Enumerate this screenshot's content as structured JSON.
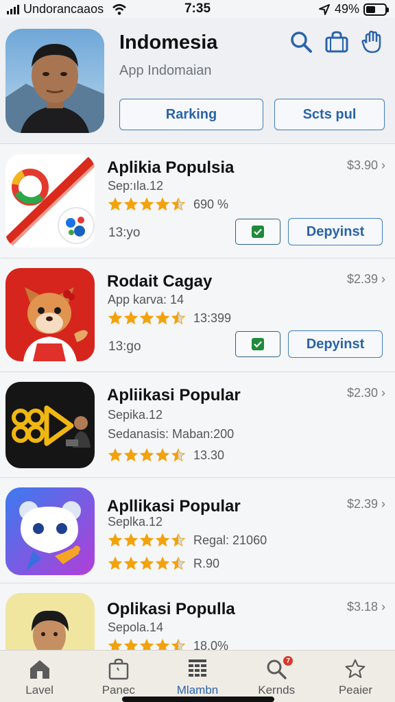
{
  "status": {
    "carrier": "Undorancaaos",
    "time": "7:35",
    "battery": "49%",
    "battery_level": 0.49
  },
  "header": {
    "title": "Indomesia",
    "subtitle": "App Indomaian",
    "buttons": [
      "Rarking",
      "Scts pul"
    ],
    "icons": [
      "search-icon",
      "shopping-bag-icon",
      "hand-icon"
    ]
  },
  "apps": [
    {
      "name": "Aplikia Populsia",
      "price": "$3.90",
      "line": "Sep:ıla.12",
      "rating_stars": 4.5,
      "rating_text": "690 %",
      "time": "13:yo",
      "action": "Depyinst",
      "icon": "color-swirl-icon"
    },
    {
      "name": "Rodait Cagay",
      "price": "$2.39",
      "line": "App karva: 14",
      "rating_stars": 4.5,
      "rating_text": "13:399",
      "time": "13:go",
      "action": "Depyinst",
      "icon": "fox-mascot-icon"
    },
    {
      "name": "Apliikasi Popular",
      "price": "$2.30",
      "line": "Sepika.12",
      "line2": "Sedanasis: Maban:200",
      "rating_stars": 4.5,
      "rating_text": "13.30",
      "icon": "play-video-icon"
    },
    {
      "name": "Apllikasi Popular",
      "price": "$2.39",
      "line": "Seplka.12",
      "rating_stars": 4.5,
      "rating_text": "Regal: 21060",
      "rating2_stars": 4.5,
      "rating2_text": "R.90",
      "icon": "bird-character-icon"
    },
    {
      "name": "Oplikasi Populla",
      "price": "$3.18",
      "line": "Sepola.14",
      "rating_stars": 4.5,
      "rating_text": "18.0%",
      "icon": "person-photo-icon"
    }
  ],
  "tabs": [
    {
      "label": "Lavel",
      "icon": "home-icon"
    },
    {
      "label": "Panec",
      "icon": "bag-icon"
    },
    {
      "label": "Mlambn",
      "icon": "grid-icon",
      "active": true
    },
    {
      "label": "Kernds",
      "icon": "search-icon",
      "badge": "7"
    },
    {
      "label": "Peaier",
      "icon": "star-icon"
    }
  ],
  "colors": {
    "accent": "#2a63a8",
    "star": "#f2a20c",
    "check": "#1f8a3b"
  }
}
